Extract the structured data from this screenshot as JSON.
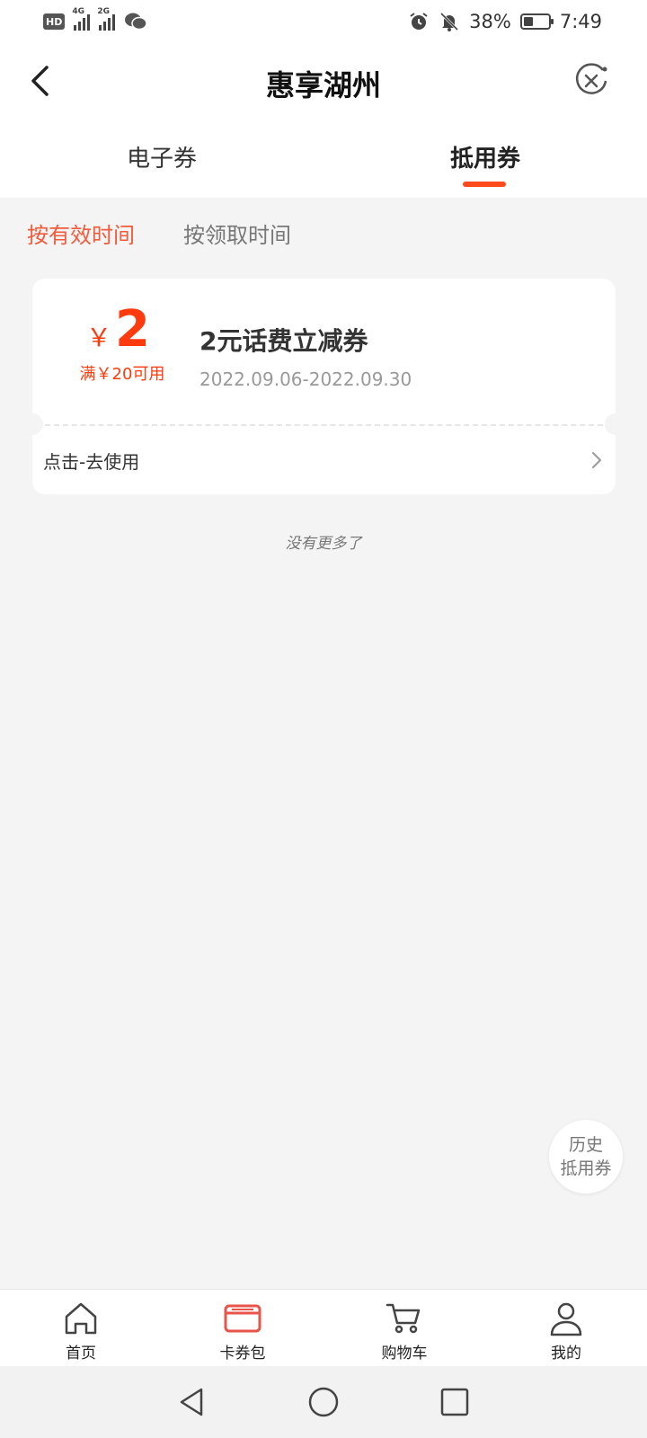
{
  "status_bar": {
    "hd": "HD",
    "sim1": "4G",
    "sim2": "2G",
    "battery_percent": "38%",
    "battery_level": 0.38,
    "time": "7:49"
  },
  "header": {
    "title": "惠享湖州"
  },
  "tabs": [
    {
      "label": "电子券",
      "active": false
    },
    {
      "label": "抵用券",
      "active": true
    }
  ],
  "sort": {
    "by_valid_time": "按有效时间",
    "by_receive_time": "按领取时间"
  },
  "coupon": {
    "currency": "￥",
    "amount": "2",
    "condition": "满￥20可用",
    "title": "2元话费立减券",
    "date_range": "2022.09.06-2022.09.30",
    "action": "点击-去使用"
  },
  "no_more_text": "没有更多了",
  "history": {
    "line1": "历史",
    "line2": "抵用券"
  },
  "bottom_nav": [
    {
      "label": "首页",
      "icon": "home-icon"
    },
    {
      "label": "卡券包",
      "icon": "card-wallet-icon",
      "active": true
    },
    {
      "label": "购物车",
      "icon": "cart-icon"
    },
    {
      "label": "我的",
      "icon": "user-icon"
    }
  ],
  "colors": {
    "accent": "#ff3b0e",
    "sort_active": "#f15a3b",
    "wallet_icon": "#e8534a"
  }
}
